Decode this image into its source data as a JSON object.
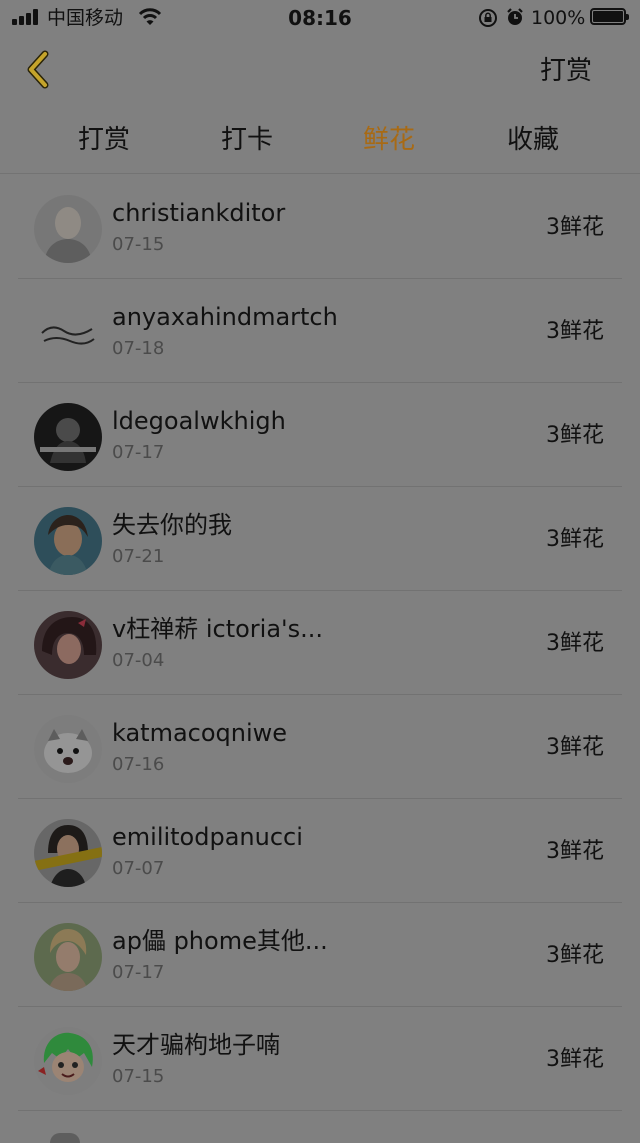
{
  "status_bar": {
    "carrier": "中国移动",
    "time": "08:16",
    "battery": "100%"
  },
  "nav": {
    "action_label": "打赏"
  },
  "tabs": [
    {
      "label": "打赏",
      "active": false
    },
    {
      "label": "打卡",
      "active": false
    },
    {
      "label": "鲜花",
      "active": true
    },
    {
      "label": "收藏",
      "active": false
    }
  ],
  "list": [
    {
      "name": "christiankditor",
      "date": "07-15",
      "amount": "3鲜花"
    },
    {
      "name": "anyaxahindmartch",
      "date": "07-18",
      "amount": "3鲜花"
    },
    {
      "name": "ldegoalwkhigh",
      "date": "07-17",
      "amount": "3鲜花"
    },
    {
      "name": "失去你的我",
      "date": "07-21",
      "amount": "3鲜花"
    },
    {
      "name": "v枉禅菥 ictoria's...",
      "date": "07-04",
      "amount": "3鲜花"
    },
    {
      "name": "katmacoqniwe",
      "date": "07-16",
      "amount": "3鲜花"
    },
    {
      "name": "emilitodpanucci",
      "date": "07-07",
      "amount": "3鲜花"
    },
    {
      "name": "ap儡 phome其他...",
      "date": "07-17",
      "amount": "3鲜花"
    },
    {
      "name": "天才骗枸地子喃",
      "date": "07-15",
      "amount": "3鲜花"
    }
  ],
  "colors": {
    "active_tab": "#a86a14",
    "overlay_background": "#808080"
  }
}
